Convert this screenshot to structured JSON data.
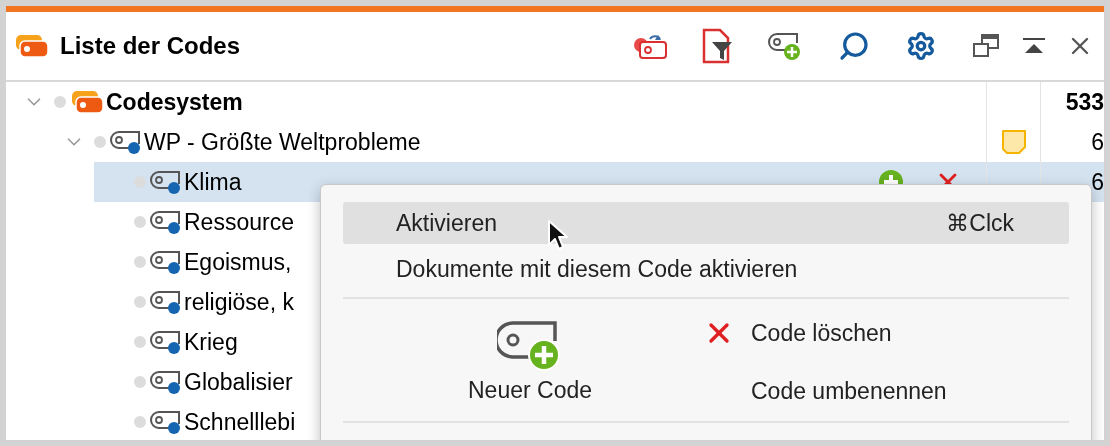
{
  "panel": {
    "title": "Liste der Codes"
  },
  "tree": [
    {
      "label": "Codesystem",
      "kind": "root",
      "selected": false,
      "expanded": true,
      "memo": false,
      "count": "533",
      "children": [
        {
          "label": "WP - Größte Weltprobleme",
          "kind": "code",
          "selected": false,
          "expanded": true,
          "memo": true,
          "count": "6",
          "children": [
            {
              "label": "Klima",
              "kind": "code",
              "selected": true,
              "memo": false,
              "count": "6"
            },
            {
              "label": "Ressource",
              "kind": "code",
              "selected": false,
              "memo": false
            },
            {
              "label": "Egoismus,",
              "kind": "code",
              "selected": false,
              "memo": false
            },
            {
              "label": "religiöse, k",
              "kind": "code",
              "selected": false,
              "memo": false
            },
            {
              "label": "Krieg",
              "kind": "code",
              "selected": false,
              "memo": false
            },
            {
              "label": "Globalisier",
              "kind": "code",
              "selected": false,
              "memo": false
            },
            {
              "label": "Schnelllebi",
              "kind": "code",
              "selected": false,
              "memo": false
            }
          ]
        }
      ]
    }
  ],
  "menu": {
    "items": [
      {
        "label": "Aktivieren",
        "shortcut": "⌘Clck",
        "selected": true
      },
      {
        "label": "Dokumente mit diesem Code aktivieren",
        "selected": false
      }
    ],
    "actions": [
      {
        "label": "Neuer Code",
        "kind": "new"
      },
      {
        "label": "Code löschen",
        "kind": "delete"
      },
      {
        "label": "Code umbenennen",
        "kind": "rename"
      }
    ]
  }
}
